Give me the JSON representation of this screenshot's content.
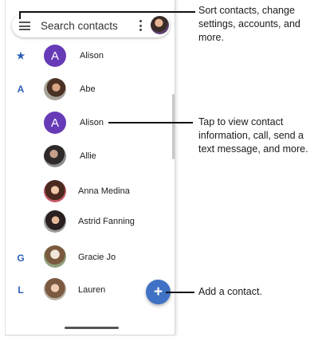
{
  "search": {
    "placeholder": "Search contacts",
    "menu_icon": "hamburger-menu-icon",
    "more_icon": "more-vert-icon",
    "account_icon": "account-avatar"
  },
  "contacts": [
    {
      "section": "★",
      "avatar_letter": "A",
      "avatar_color": "#673ab7",
      "name": "Alison"
    },
    {
      "section": "A",
      "avatar_letter": "",
      "name": "Abe"
    },
    {
      "section": "",
      "avatar_letter": "A",
      "avatar_color": "#673ab7",
      "name": "Alison"
    },
    {
      "section": "",
      "avatar_letter": "",
      "name": "Allie"
    },
    {
      "section": "",
      "avatar_letter": "",
      "name": "Anna Medina"
    },
    {
      "section": "",
      "avatar_letter": "",
      "name": "Astrid Fanning"
    },
    {
      "section": "G",
      "avatar_letter": "",
      "name": "Gracie Jo"
    },
    {
      "section": "L",
      "avatar_letter": "",
      "name": "Lauren"
    }
  ],
  "fab": {
    "label": "+",
    "icon": "add-icon"
  },
  "callouts": {
    "menu": "Sort contacts, change settings, accounts, and more.",
    "contact": "Tap to view contact information, call, send a text message, and more.",
    "add": "Add a contact."
  },
  "colors": {
    "accent": "#2d5fb8",
    "fab": "#3f72c4",
    "letter_avatar": "#673ab7"
  }
}
